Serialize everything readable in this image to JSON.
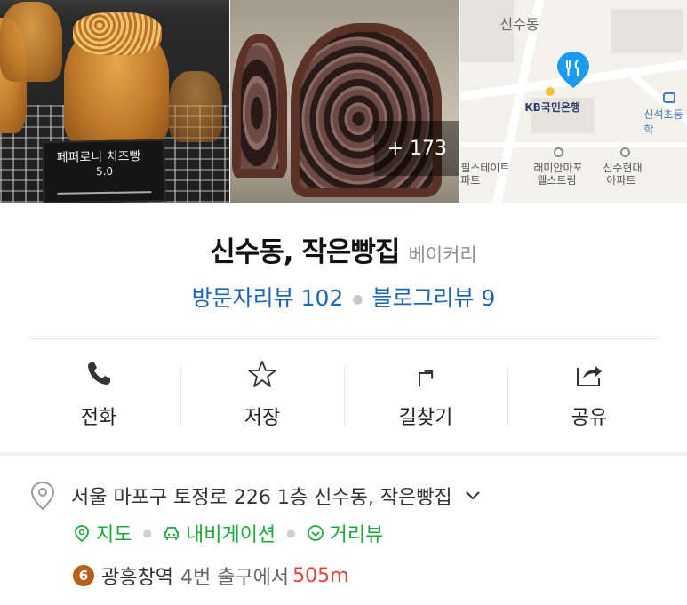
{
  "photos": {
    "bread_sign_line1": "페퍼로니 치즈빵",
    "bread_sign_line2": "5.0",
    "more_count_label": "+ 173"
  },
  "map": {
    "area_label": "신수동",
    "bank_label": "KB국민은행",
    "school_label": "신석초등학",
    "poi_left_line1": "필스테이트",
    "poi_left_line2": "파트",
    "poi_mid_line1": "래미안마포",
    "poi_mid_line2": "웰스트림",
    "poi_right_line1": "신수현대",
    "poi_right_line2": "아파트",
    "pin_color": "#1b9bf0"
  },
  "place": {
    "name": "신수동, 작은빵집",
    "category": "베이커리",
    "visitor_reviews_label": "방문자리뷰 102",
    "blog_reviews_label": "블로그리뷰 9"
  },
  "actions": [
    {
      "label": "전화",
      "icon": "phone-icon"
    },
    {
      "label": "저장",
      "icon": "star-icon"
    },
    {
      "label": "길찾기",
      "icon": "directions-icon"
    },
    {
      "label": "공유",
      "icon": "share-icon"
    }
  ],
  "info": {
    "address": "서울 마포구 토정로 226 1층 신수동, 작은빵집",
    "map_link": "지도",
    "navigation_link": "내비게이션",
    "street_view_link": "거리뷰",
    "subway_line": "6",
    "station": "광흥창역",
    "exit_text": "4번 출구에서",
    "distance": "505m"
  },
  "colors": {
    "review_blue": "#1e64b4",
    "link_green": "#1ea83a",
    "distance_red": "#e0463a",
    "line6_brown": "#b8601a"
  }
}
